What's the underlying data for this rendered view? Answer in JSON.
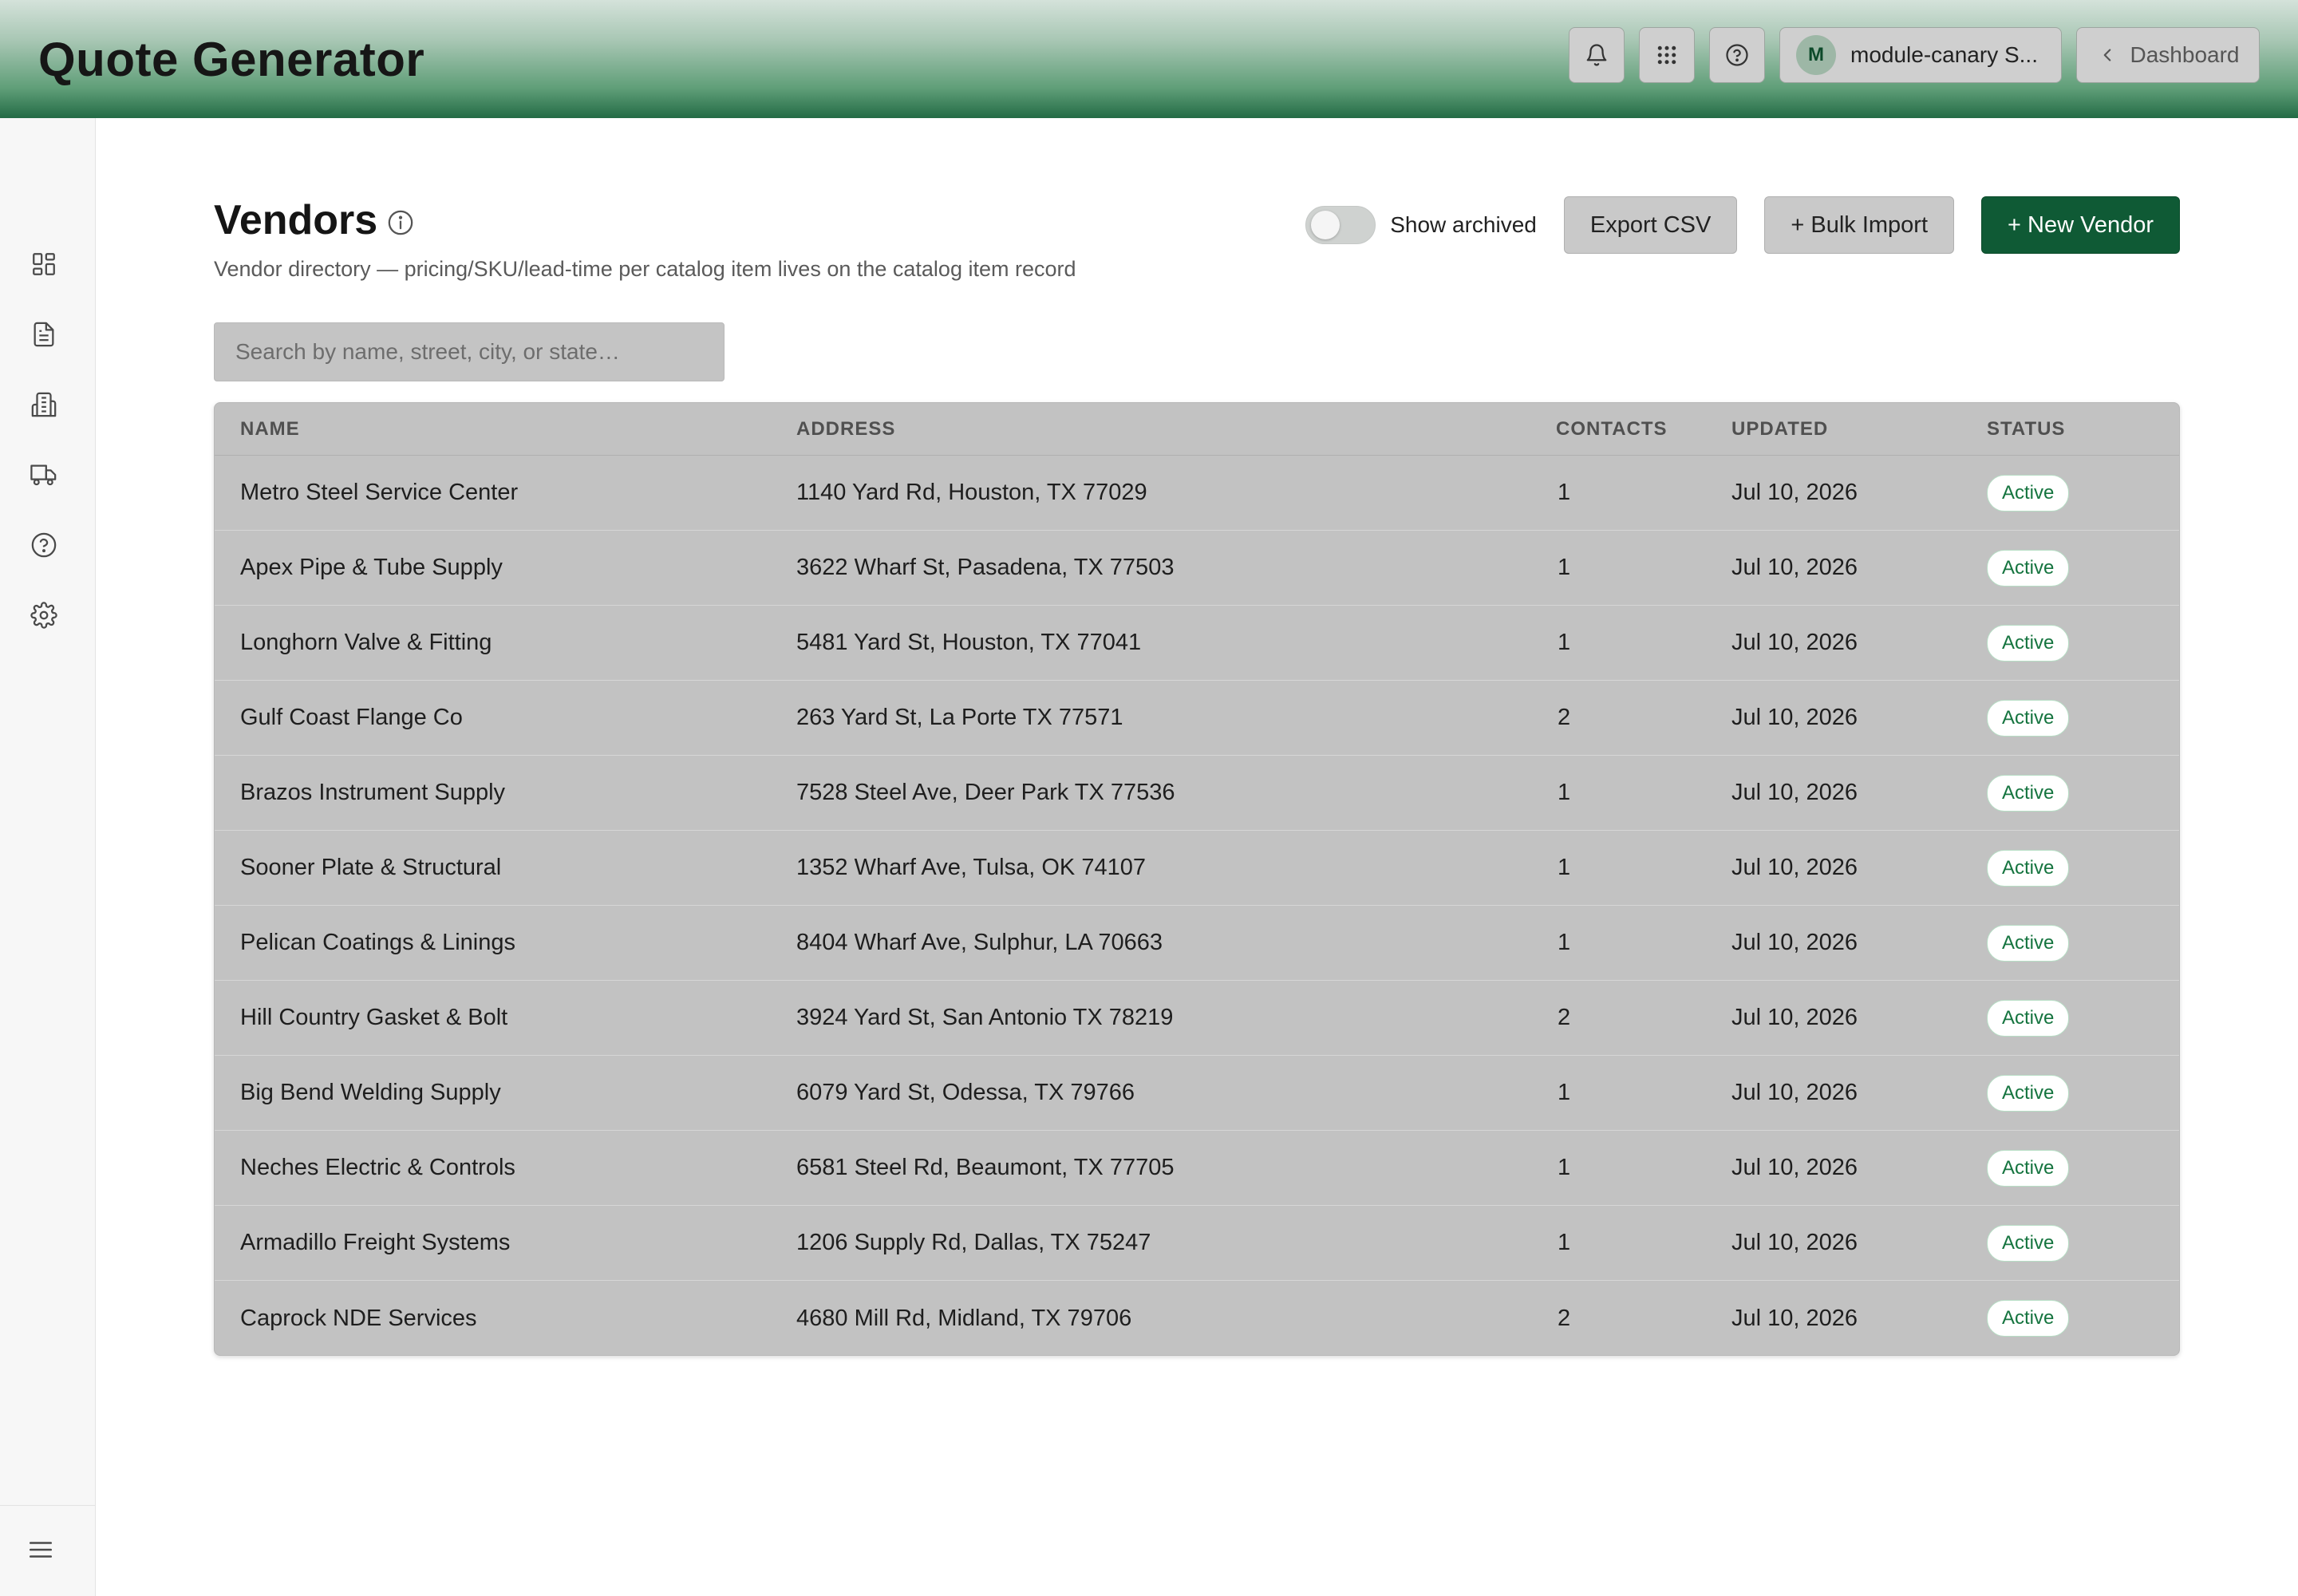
{
  "header": {
    "app_title": "Quote Generator",
    "account_initial": "M",
    "account_name": "module-canary S...",
    "dashboard_label": "Dashboard"
  },
  "page": {
    "title": "Vendors",
    "subtitle": "Vendor directory — pricing/SKU/lead-time per catalog item lives on the catalog item record"
  },
  "toolbar": {
    "show_archived_label": "Show archived",
    "show_archived_on": false,
    "export_label": "Export CSV",
    "bulk_import_label": "+ Bulk Import",
    "new_vendor_label": "+ New Vendor"
  },
  "search": {
    "placeholder": "Search by name, street, city, or state…"
  },
  "table": {
    "columns": [
      "NAME",
      "ADDRESS",
      "CONTACTS",
      "UPDATED",
      "STATUS"
    ],
    "rows": [
      {
        "name": "Metro Steel Service Center",
        "address": "1140 Yard Rd, Houston, TX 77029",
        "contacts": "1",
        "updated": "Jul 10, 2026",
        "status": "Active"
      },
      {
        "name": "Apex Pipe & Tube Supply",
        "address": "3622 Wharf St, Pasadena, TX 77503",
        "contacts": "1",
        "updated": "Jul 10, 2026",
        "status": "Active"
      },
      {
        "name": "Longhorn Valve & Fitting",
        "address": "5481 Yard St, Houston, TX 77041",
        "contacts": "1",
        "updated": "Jul 10, 2026",
        "status": "Active"
      },
      {
        "name": "Gulf Coast Flange Co",
        "address": "263 Yard St, La Porte TX 77571",
        "contacts": "2",
        "updated": "Jul 10, 2026",
        "status": "Active"
      },
      {
        "name": "Brazos Instrument Supply",
        "address": "7528 Steel Ave, Deer Park TX 77536",
        "contacts": "1",
        "updated": "Jul 10, 2026",
        "status": "Active"
      },
      {
        "name": "Sooner Plate & Structural",
        "address": "1352 Wharf Ave, Tulsa, OK 74107",
        "contacts": "1",
        "updated": "Jul 10, 2026",
        "status": "Active"
      },
      {
        "name": "Pelican Coatings & Linings",
        "address": "8404 Wharf Ave, Sulphur, LA 70663",
        "contacts": "1",
        "updated": "Jul 10, 2026",
        "status": "Active"
      },
      {
        "name": "Hill Country Gasket & Bolt",
        "address": "3924 Yard St, San Antonio TX 78219",
        "contacts": "2",
        "updated": "Jul 10, 2026",
        "status": "Active"
      },
      {
        "name": "Big Bend Welding Supply",
        "address": "6079 Yard St, Odessa, TX 79766",
        "contacts": "1",
        "updated": "Jul 10, 2026",
        "status": "Active"
      },
      {
        "name": "Neches Electric & Controls",
        "address": "6581 Steel Rd, Beaumont, TX 77705",
        "contacts": "1",
        "updated": "Jul 10, 2026",
        "status": "Active"
      },
      {
        "name": "Armadillo Freight Systems",
        "address": "1206 Supply Rd, Dallas, TX 75247",
        "contacts": "1",
        "updated": "Jul 10, 2026",
        "status": "Active"
      },
      {
        "name": "Caprock NDE Services",
        "address": "4680 Mill Rd, Midland, TX 79706",
        "contacts": "2",
        "updated": "Jul 10, 2026",
        "status": "Active"
      }
    ]
  },
  "icons": {
    "header": [
      "bell-icon",
      "apps-grid-icon",
      "help-circle-icon",
      "chevron-left-icon"
    ],
    "sidebar": [
      "dashboard-icon",
      "document-icon",
      "building-icon",
      "truck-icon",
      "help-icon",
      "gear-icon",
      "menu-icon"
    ]
  },
  "colors": {
    "primary": "#0f5a35",
    "status_active_text": "#15743f",
    "header_gradient_start": "#d4e2da",
    "header_gradient_end": "#236b45"
  }
}
